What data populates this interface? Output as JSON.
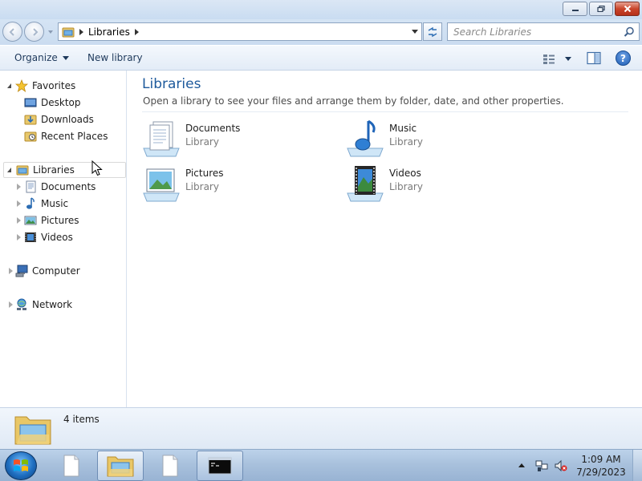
{
  "window": {
    "buttons": {
      "minimize": "minimize",
      "maximize": "restore",
      "close": "close"
    }
  },
  "address": {
    "icon": "libraries-icon",
    "crumbs": [
      "Libraries"
    ],
    "search_placeholder": "Search Libraries"
  },
  "toolbar": {
    "organize": "Organize",
    "new_library": "New library",
    "help": "?"
  },
  "nav": {
    "favorites": "Favorites",
    "desktop": "Desktop",
    "downloads": "Downloads",
    "recent": "Recent Places",
    "libraries": "Libraries",
    "documents": "Documents",
    "music": "Music",
    "pictures": "Pictures",
    "videos": "Videos",
    "computer": "Computer",
    "network": "Network"
  },
  "content": {
    "title": "Libraries",
    "description": "Open a library to see your files and arrange them by folder, date, and other properties.",
    "libraries": [
      {
        "name": "Documents",
        "type": "Library",
        "icon": "documents-library-icon"
      },
      {
        "name": "Music",
        "type": "Library",
        "icon": "music-library-icon"
      },
      {
        "name": "Pictures",
        "type": "Library",
        "icon": "pictures-library-icon"
      },
      {
        "name": "Videos",
        "type": "Library",
        "icon": "videos-library-icon"
      }
    ]
  },
  "details": {
    "count": "4 items"
  },
  "taskbar": {
    "items": [
      "blank-document-icon",
      "explorer-icon",
      "blank-document-icon",
      "command-prompt-icon"
    ],
    "clock_time": "1:09 AM",
    "clock_date": "7/29/2023"
  },
  "colors": {
    "title_blue": "#1e5a9c",
    "accent": "#1e395b"
  }
}
